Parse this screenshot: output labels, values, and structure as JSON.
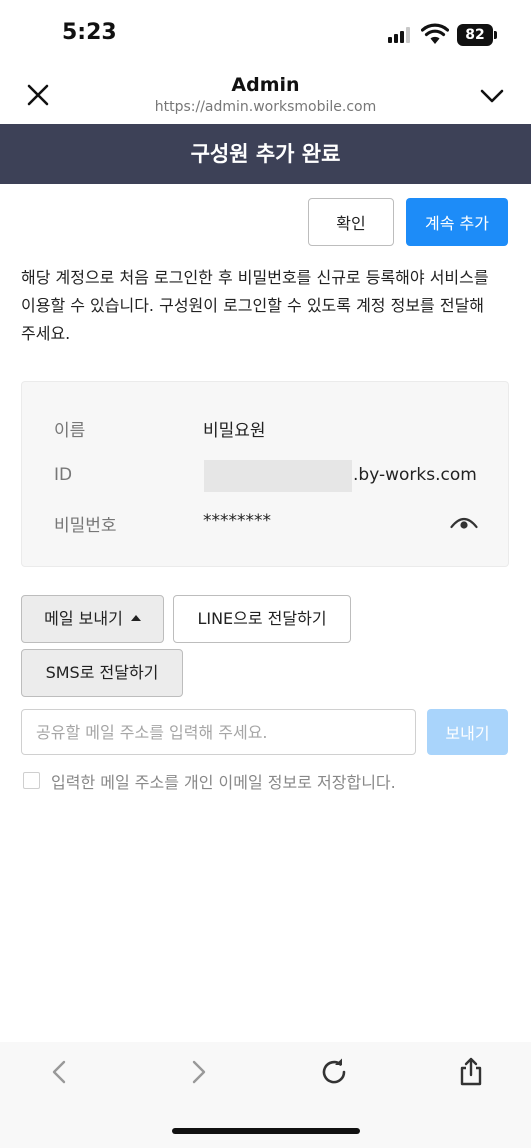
{
  "status_bar": {
    "time": "5:23",
    "battery": "82"
  },
  "browser": {
    "title": "Admin",
    "url": "https://admin.worksmobile.com"
  },
  "page": {
    "heading": "구성원 추가 완료",
    "confirm_label": "확인",
    "continue_label": "계속 추가",
    "notice": "해당 계정으로 처음 로그인한 후 비밀번호를 신규로 등록해야 서비스를 이용할 수 있습니다. 구성원이 로그인할 수 있도록 계정 정보를 전달해 주세요."
  },
  "account": {
    "name_label": "이름",
    "name_value": "비밀요원",
    "id_label": "ID",
    "id_domain": ".by-works.com",
    "password_label": "비밀번호",
    "password_value": "********"
  },
  "share": {
    "email_label": "메일 보내기",
    "line_label": "LINE으로 전달하기",
    "sms_label": "SMS로 전달하기",
    "email_placeholder": "공유할 메일 주소를 입력해 주세요.",
    "send_label": "보내기",
    "save_label": "입력한 메일 주소를 개인 이메일 정보로 저장합니다."
  },
  "colors": {
    "title_bar": "#3d4157",
    "primary": "#1d8cf8",
    "primary_disabled": "#a9d4fb"
  },
  "icons": [
    "close-icon",
    "chevron-down-icon",
    "eye-icon",
    "caret-up-icon",
    "back-arrow-icon",
    "forward-arrow-icon",
    "reload-icon",
    "share-icon"
  ]
}
